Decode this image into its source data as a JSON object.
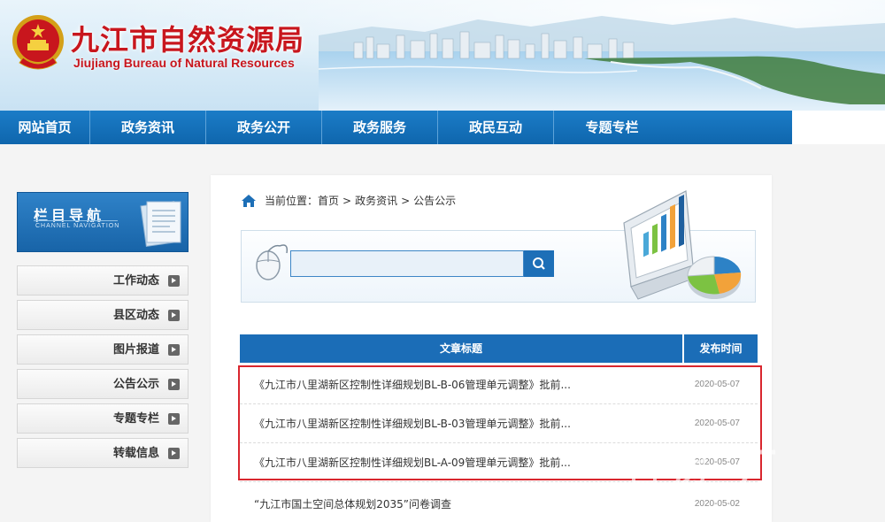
{
  "header": {
    "title": "九江市自然资源局",
    "subtitle": "Jiujiang Bureau of Natural Resources"
  },
  "nav": {
    "items": [
      {
        "label": "网站首页"
      },
      {
        "label": "政务资讯"
      },
      {
        "label": "政务公开"
      },
      {
        "label": "政务服务"
      },
      {
        "label": "政民互动"
      },
      {
        "label": "专题专栏"
      }
    ]
  },
  "sidebar": {
    "heading": "栏目导航",
    "heading_en": "CHANNEL NAVIGATION",
    "items": [
      {
        "label": "工作动态"
      },
      {
        "label": "县区动态"
      },
      {
        "label": "图片报道"
      },
      {
        "label": "公告公示"
      },
      {
        "label": "专题专栏"
      },
      {
        "label": "转载信息"
      }
    ]
  },
  "breadcrumb": {
    "prefix": "当前位置：",
    "items": [
      "首页",
      "政务资讯",
      "公告公示"
    ],
    "separator": ">"
  },
  "search": {
    "value": "",
    "icon": "search-icon"
  },
  "table": {
    "headers": {
      "title": "文章标题",
      "date": "发布时间"
    },
    "rows": [
      {
        "title": "《九江市八里湖新区控制性详细规划BL-B-06管理单元调整》批前...",
        "date": "2020-05-07"
      },
      {
        "title": "《九江市八里湖新区控制性详细规划BL-B-03管理单元调整》批前...",
        "date": "2020-05-07"
      },
      {
        "title": "《九江市八里湖新区控制性详细规划BL-A-09管理单元调整》批前...",
        "date": "2020-05-07"
      },
      {
        "title": "“九江市国土空间总体规划2035”问卷调查",
        "date": "2020-05-02"
      }
    ]
  },
  "watermark": {
    "text": "房"
  },
  "colors": {
    "nav_blue": "#1b6db7",
    "title_red": "#c8161d",
    "highlight_red": "#d9262e"
  }
}
